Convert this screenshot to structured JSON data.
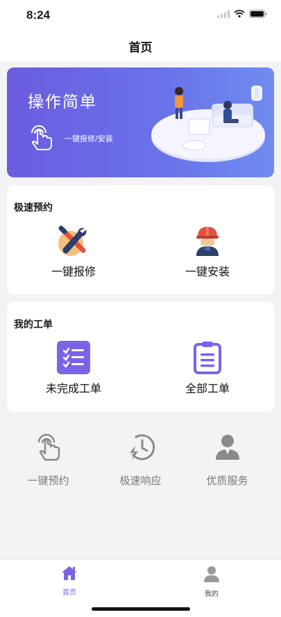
{
  "status_bar": {
    "time": "8:24"
  },
  "nav": {
    "title": "首页"
  },
  "banner": {
    "title": "操作简单",
    "subtitle": "一键报修/安装"
  },
  "quick_booking": {
    "title": "极速预约",
    "items": [
      {
        "label": "一键报修",
        "icon": "wrench-screwdriver-icon"
      },
      {
        "label": "一键安装",
        "icon": "worker-helmet-icon"
      }
    ]
  },
  "my_orders": {
    "title": "我的工单",
    "items": [
      {
        "label": "未完成工单",
        "icon": "checklist-icon"
      },
      {
        "label": "全部工单",
        "icon": "clipboard-icon"
      }
    ]
  },
  "features": [
    {
      "label": "一键预约",
      "icon": "tap-hand-icon"
    },
    {
      "label": "极速响应",
      "icon": "fast-clock-icon"
    },
    {
      "label": "优质服务",
      "icon": "service-person-icon"
    }
  ],
  "tab_bar": {
    "tabs": [
      {
        "label": "首页",
        "icon": "home-icon",
        "active": true
      },
      {
        "label": "我的",
        "icon": "user-icon",
        "active": false
      }
    ]
  },
  "colors": {
    "accent": "#7b63e6",
    "banner_start": "#6a5ce0",
    "banner_end": "#6f8cf0",
    "inactive_gray": "#8a8a8a",
    "background": "#f3f3f5"
  }
}
